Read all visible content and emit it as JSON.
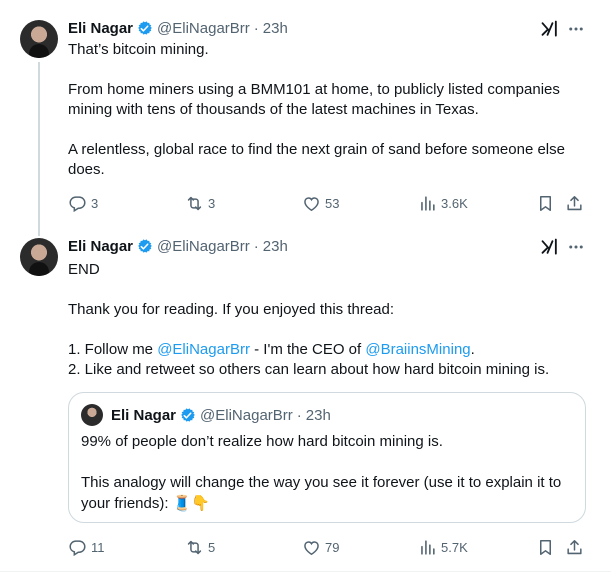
{
  "tweets": [
    {
      "author_name": "Eli Nagar",
      "handle": "@EliNagarBrr",
      "separator": "·",
      "time": "23h",
      "lines": [
        "That’s bitcoin mining.",
        "From home miners using a BMM101 at home, to publicly listed companies mining with tens of thousands of the latest machines in Texas.",
        "A relentless, global race to find the next grain of sand before someone else does."
      ],
      "replies": "3",
      "reposts": "3",
      "likes": "53",
      "views": "3.6K"
    },
    {
      "author_name": "Eli Nagar",
      "handle": "@EliNagarBrr",
      "separator": "·",
      "time": "23h",
      "line1": "END",
      "line2": "Thank you for reading. If you enjoyed this thread:",
      "line3_prefix": "1. Follow me ",
      "line3_link1": "@EliNagarBrr",
      "line3_mid": " - I'm the CEO of ",
      "line3_link2": "@BraiinsMining",
      "line3_suffix": ".",
      "line4": "2. Like and retweet so others can learn about how hard bitcoin mining is.",
      "quote": {
        "author_name": "Eli Nagar",
        "handle": "@EliNagarBrr",
        "separator": "·",
        "time": "23h",
        "line1": "99% of people don’t realize how hard bitcoin mining is.",
        "line2": "This analogy will change the way you see it forever (use it to explain it to your friends): 🧵👇"
      },
      "replies": "11",
      "reposts": "5",
      "likes": "79",
      "views": "5.7K"
    }
  ],
  "colors": {
    "text": "#0f1419",
    "secondary": "#536471",
    "link": "#1d9bf0",
    "verified": "#1d9bf0",
    "border": "#cfd9de"
  },
  "icons": [
    "verified-badge-icon",
    "grok-icon",
    "more-icon",
    "reply-icon",
    "repost-icon",
    "like-icon",
    "views-icon",
    "bookmark-icon",
    "share-icon"
  ]
}
